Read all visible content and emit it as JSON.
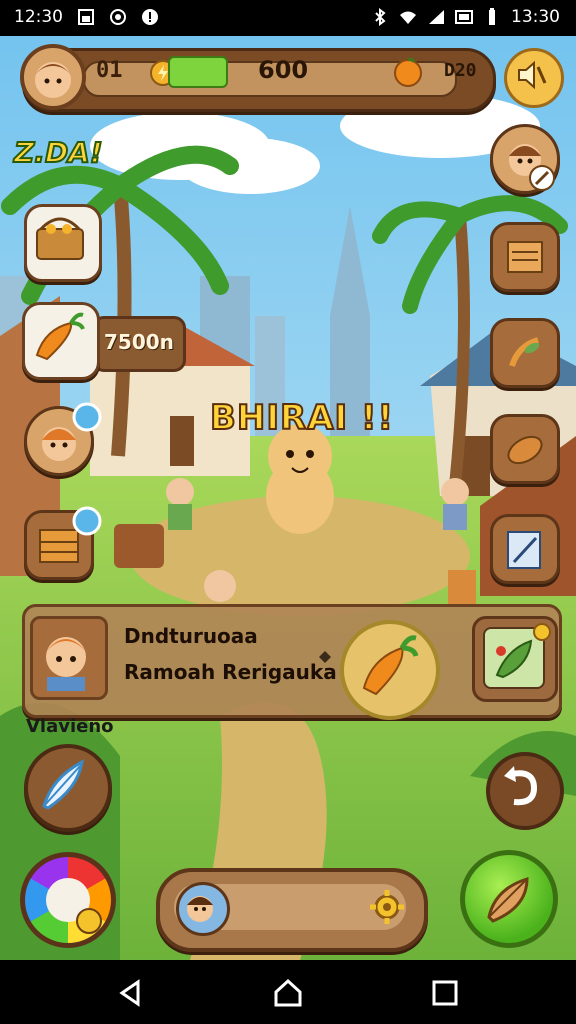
{
  "status_bar": {
    "time_left": "12:30",
    "time_right": "13:30"
  },
  "hud": {
    "level": "01",
    "coins": "600",
    "date": "D20",
    "energy_fraction": 0.35,
    "sound_icon": "speaker-mute-icon"
  },
  "left_panel": {
    "banner_text": "Z.DA!",
    "price_text": "7500n"
  },
  "scene": {
    "banner": "BHIRAI !!"
  },
  "quest": {
    "title": "Dndturuoaa",
    "subtitle": "Ramoah Rerigauka"
  },
  "bottom": {
    "label": "Vlavieno"
  },
  "colors": {
    "sky": "#8fd3f4",
    "grass": "#8fcf4e",
    "wood": "#a66c3c",
    "banner_yellow": "#ffd43a"
  }
}
